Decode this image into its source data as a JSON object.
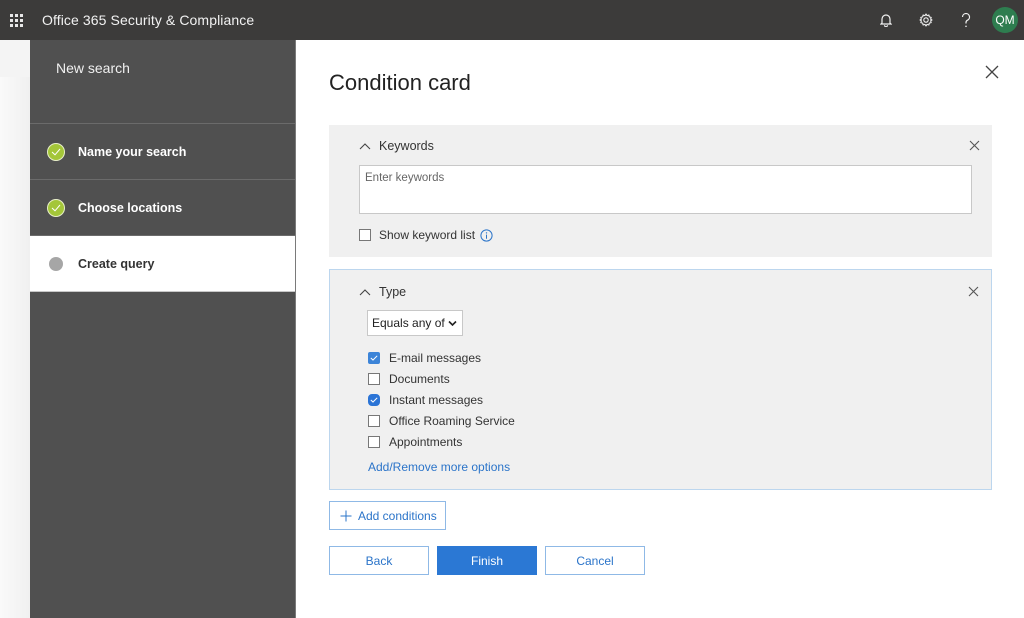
{
  "topbar": {
    "app_title": "Office 365 Security & Compliance",
    "icons": [
      "app-launcher-icon",
      "bell-icon",
      "gear-icon",
      "help-icon"
    ],
    "avatar_initials": "QM",
    "avatar_color": "#2e7d4f"
  },
  "wizard": {
    "title": "New search",
    "steps": [
      {
        "label": "Name your search",
        "status": "completed"
      },
      {
        "label": "Choose locations",
        "status": "completed"
      },
      {
        "label": "Create query",
        "status": "current"
      }
    ]
  },
  "main": {
    "title": "Condition card",
    "keywords_card": {
      "title": "Keywords",
      "input_placeholder": "Enter keywords",
      "input_value": "",
      "show_keyword_list_label": "Show keyword list",
      "show_keyword_list_checked": false
    },
    "type_card": {
      "title": "Type",
      "operator_selected": "Equals any of",
      "options": [
        {
          "label": "E-mail messages",
          "checked": true
        },
        {
          "label": "Documents",
          "checked": false
        },
        {
          "label": "Instant messages",
          "checked": true
        },
        {
          "label": "Office Roaming Service",
          "checked": false
        },
        {
          "label": "Appointments",
          "checked": false
        }
      ],
      "more_link": "Add/Remove more options"
    },
    "add_conditions_label": "Add conditions",
    "buttons": {
      "back": "Back",
      "finish": "Finish",
      "cancel": "Cancel"
    }
  },
  "colors": {
    "topbar_bg": "#3c3b3a",
    "wizard_bg": "#505050",
    "step_done": "#a4c639",
    "accent": "#2b78d4",
    "link": "#2b74c9"
  }
}
